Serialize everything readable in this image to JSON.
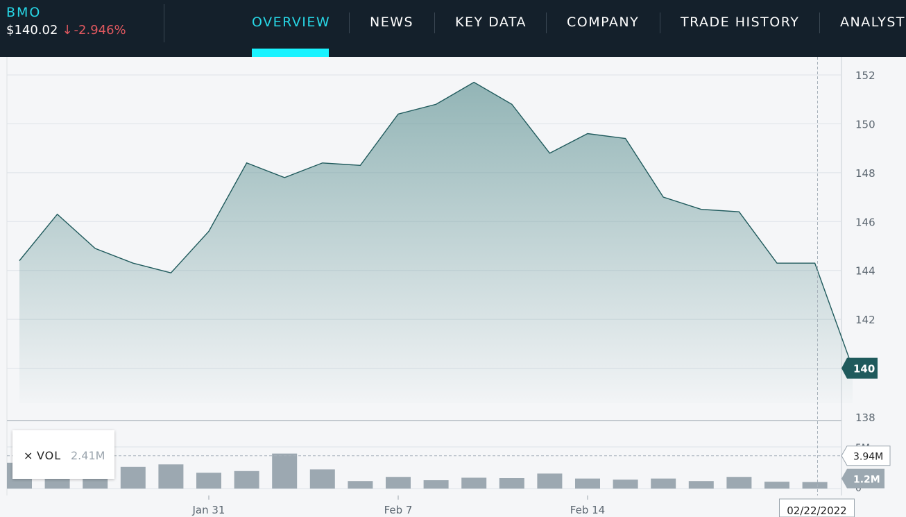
{
  "header": {
    "symbol": "BMO",
    "price": "$140.02",
    "change_arrow": "↓",
    "change": "-2.946%",
    "change_color": "#e0585f"
  },
  "nav": {
    "tabs": [
      {
        "label": "OVERVIEW",
        "active": true
      },
      {
        "label": "NEWS",
        "active": false
      },
      {
        "label": "KEY DATA",
        "active": false
      },
      {
        "label": "COMPANY",
        "active": false
      },
      {
        "label": "TRADE HISTORY",
        "active": false
      },
      {
        "label": "ANALYST",
        "active": false
      }
    ],
    "accent_color": "#19f3ff"
  },
  "chart_data": {
    "type": "area",
    "x": [
      "Jan 24",
      "Jan 25",
      "Jan 26",
      "Jan 27",
      "Jan 28",
      "Jan 31",
      "Feb 1",
      "Feb 2",
      "Feb 3",
      "Feb 4",
      "Feb 7",
      "Feb 8",
      "Feb 9",
      "Feb 10",
      "Feb 11",
      "Feb 14",
      "Feb 15",
      "Feb 16",
      "Feb 17",
      "Feb 18",
      "Feb 21",
      "Feb 22",
      "Feb 23"
    ],
    "price": [
      144.4,
      146.3,
      144.9,
      144.3,
      143.9,
      145.6,
      148.4,
      147.8,
      148.4,
      148.3,
      150.4,
      150.8,
      151.7,
      150.8,
      148.8,
      149.6,
      149.4,
      147.0,
      146.5,
      146.4,
      144.3,
      144.3,
      140.0
    ],
    "volume_millions": [
      3.1,
      3.1,
      3.1,
      2.6,
      2.9,
      1.9,
      2.1,
      4.2,
      2.3,
      0.9,
      1.4,
      1.0,
      1.3,
      1.25,
      1.8,
      1.2,
      1.07,
      1.2,
      0.9,
      1.4,
      0.82,
      0.78
    ],
    "price_axis": {
      "ticks": [
        "152",
        "150",
        "148",
        "146",
        "144",
        "142",
        "140",
        "138"
      ],
      "ylim": [
        138,
        152.5
      ]
    },
    "volume_axis": {
      "ticks": [
        "5M",
        "0"
      ],
      "ylim": [
        0,
        5
      ]
    },
    "x_ticks": [
      "Jan 31",
      "Feb 7",
      "Feb 14"
    ],
    "last_price_label": "140",
    "crosshair_date": "02/22/2022",
    "crosshair_volume": "3.94M",
    "last_volume_label": "1.2M",
    "volume_legend": {
      "close": "×",
      "label": "VOL",
      "value": "2.41M"
    },
    "line_color": "#1f5a5c",
    "area_color": "#6c9b9c",
    "bar_color": "#9ca8b1",
    "grid": true
  }
}
